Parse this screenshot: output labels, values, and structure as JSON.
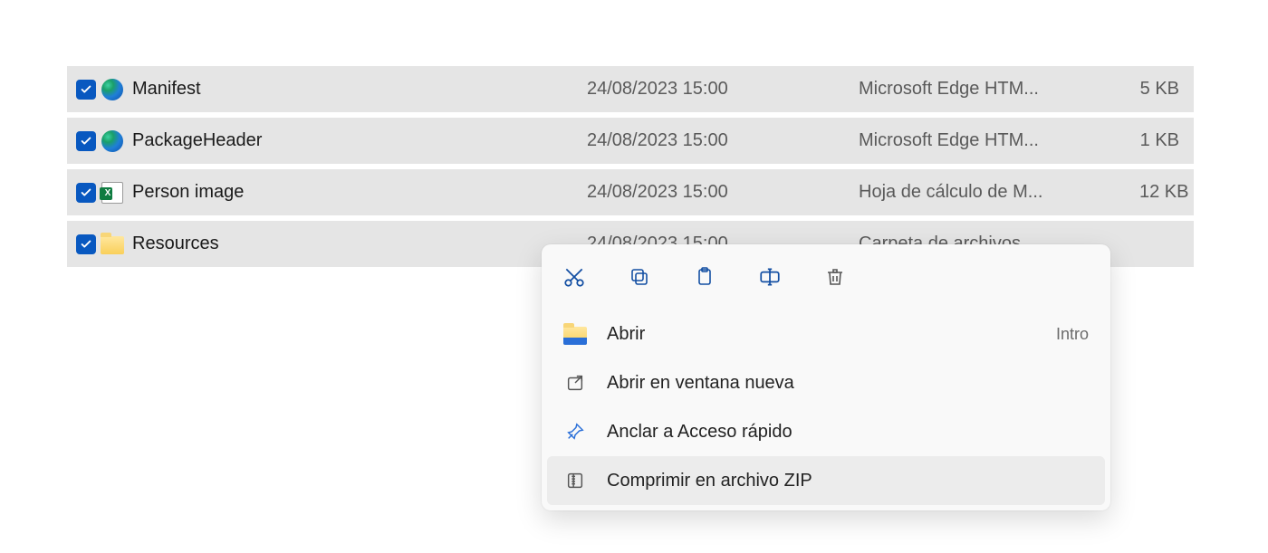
{
  "files": [
    {
      "name": "Manifest",
      "date": "24/08/2023 15:00",
      "type": "Microsoft Edge HTM...",
      "size": "5 KB",
      "icon": "edge",
      "checked": true
    },
    {
      "name": "PackageHeader",
      "date": "24/08/2023 15:00",
      "type": "Microsoft Edge HTM...",
      "size": "1 KB",
      "icon": "edge",
      "checked": true
    },
    {
      "name": "Person image",
      "date": "24/08/2023 15:00",
      "type": "Hoja de cálculo de M...",
      "size": "12 KB",
      "icon": "excel",
      "checked": true
    },
    {
      "name": "Resources",
      "date": "24/08/2023 15:00",
      "type": "Carpeta de archivos",
      "size": "",
      "icon": "folder",
      "checked": true
    }
  ],
  "context_menu": {
    "toolbar": [
      {
        "name": "cut",
        "icon": "cut"
      },
      {
        "name": "copy",
        "icon": "copy"
      },
      {
        "name": "paste",
        "icon": "paste"
      },
      {
        "name": "rename",
        "icon": "rename"
      },
      {
        "name": "delete",
        "icon": "delete"
      }
    ],
    "items": [
      {
        "label": "Abrir",
        "shortcut": "Intro",
        "icon": "folder-open",
        "highlight": false
      },
      {
        "label": "Abrir en ventana nueva",
        "shortcut": "",
        "icon": "open-window",
        "highlight": false
      },
      {
        "label": "Anclar a Acceso rápido",
        "shortcut": "",
        "icon": "pin",
        "highlight": false
      },
      {
        "label": "Comprimir en archivo ZIP",
        "shortcut": "",
        "icon": "zip",
        "highlight": true
      }
    ]
  }
}
